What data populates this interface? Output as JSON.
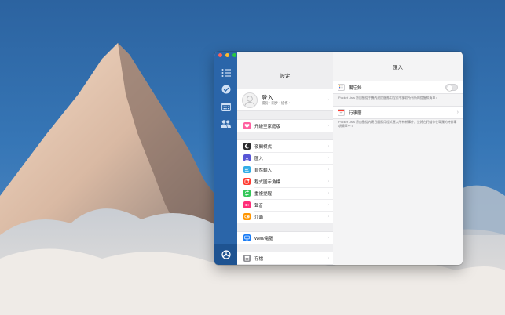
{
  "window": {
    "sidebar_icons": [
      "list-icon",
      "checkmark-icon",
      "calendar-icon",
      "people-icon"
    ],
    "active_icon": "settings-icon"
  },
  "settings": {
    "title": "設定",
    "profile": {
      "title": "登入",
      "subtitle": "備份 • 同步 • 協作 •"
    },
    "upgrade_label": "升級至家庭版",
    "items": [
      {
        "label": "夜間模式",
        "icon": "moon-icon",
        "color": "#2b2b2d"
      },
      {
        "label": "匯入",
        "icon": "import-icon",
        "color": "#5856d6"
      },
      {
        "label": "自然輸入",
        "icon": "text-input-icon",
        "color": "#32ade6"
      },
      {
        "label": "程式圖示角標",
        "icon": "badge-icon",
        "color": "#ff3b30"
      },
      {
        "label": "重複提醒",
        "icon": "repeat-icon",
        "color": "#34c759"
      },
      {
        "label": "聲音",
        "icon": "speaker-icon",
        "color": "#ff2d78"
      },
      {
        "label": "介面",
        "icon": "interface-icon",
        "color": "#ff9500"
      }
    ],
    "web_label": "Web/電腦",
    "archive_label": "存檔",
    "colors": {
      "upgrade": "#ff5fa0",
      "web": "#1a7cf5",
      "archive": "#8e8e93"
    }
  },
  "import": {
    "title": "匯入",
    "reminders_label": "備忘錄",
    "reminders_desc": "Pocket Lists 將自動從手機內建提醒應用程式中獲取所有新的提醒和清單 •",
    "calendar_label": "行事曆",
    "calendar_desc": "Pocket Lists 將自動從內建日曆應用程式匯入所有新事件，並將它們儲存在單獨的待辦事項清單中 •"
  }
}
